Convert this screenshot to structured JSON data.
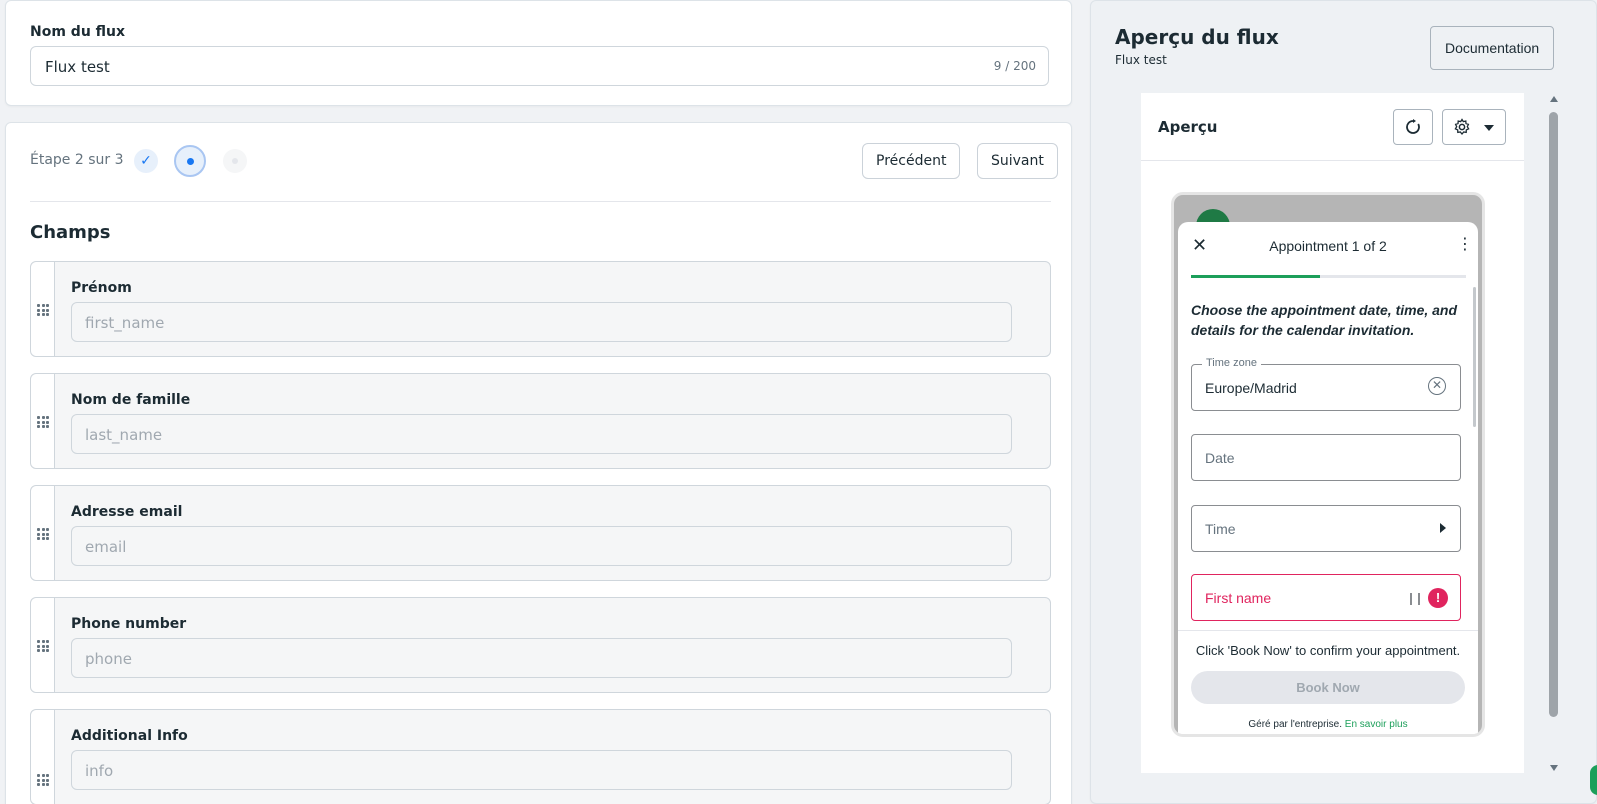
{
  "flow_name": {
    "label": "Nom du flux",
    "value": "Flux test",
    "counter": "9 / 200"
  },
  "steps": {
    "text": "Étape 2 sur 3",
    "current": 2,
    "total": 3,
    "prev_label": "Précédent",
    "next_label": "Suivant"
  },
  "fields_section": {
    "title": "Champs",
    "fields": [
      {
        "label": "Prénom",
        "placeholder": "first_name"
      },
      {
        "label": "Nom de famille",
        "placeholder": "last_name"
      },
      {
        "label": "Adresse email",
        "placeholder": "email"
      },
      {
        "label": "Phone number",
        "placeholder": "phone"
      },
      {
        "label": "Additional Info",
        "placeholder": "info"
      }
    ]
  },
  "preview_panel": {
    "title": "Aperçu du flux",
    "subtitle": "Flux test",
    "doc_label": "Documentation",
    "inner_title": "Aperçu"
  },
  "phone": {
    "title": "Appointment 1 of 2",
    "progress": 0.47,
    "intro": "Choose the appointment date, time, and details for the calendar invitation.",
    "timezone_legend": "Time zone",
    "timezone_value": "Europe/Madrid",
    "date_placeholder": "Date",
    "time_placeholder": "Time",
    "first_name_placeholder": "First name",
    "footer_text": "Click 'Book Now' to confirm your appointment.",
    "book_label": "Book Now",
    "managed_text": "Géré par l'entreprise.",
    "learn_more": "En savoir plus"
  },
  "colors": {
    "accent": "#1877f2",
    "brand_green": "#1c9f5a",
    "error": "#e0245e"
  }
}
